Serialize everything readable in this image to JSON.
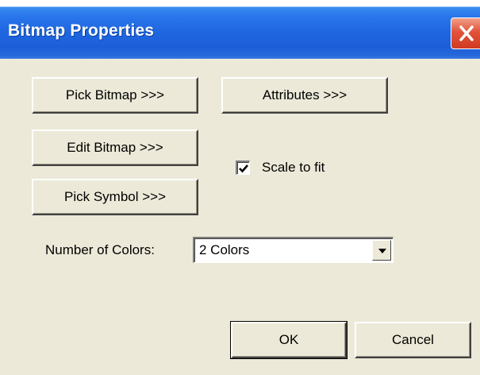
{
  "window": {
    "title": "Bitmap Properties"
  },
  "buttons": {
    "pick_bitmap": "Pick Bitmap >>>",
    "attributes": "Attributes >>>",
    "edit_bitmap": "Edit Bitmap >>>",
    "pick_symbol": "Pick Symbol >>>",
    "ok": "OK",
    "cancel": "Cancel"
  },
  "scale_to_fit": {
    "label": "Scale to fit",
    "checked": true
  },
  "colors": {
    "label": "Number of Colors:",
    "selected": "2 Colors"
  },
  "icons": {
    "close": "close-icon",
    "checkmark": "checkmark-icon",
    "dropdown": "dropdown-arrow-icon"
  },
  "theme": {
    "title_bar": "#2a76ec",
    "dialog_bg": "#ece9d8",
    "close_button": "#e1533a"
  }
}
